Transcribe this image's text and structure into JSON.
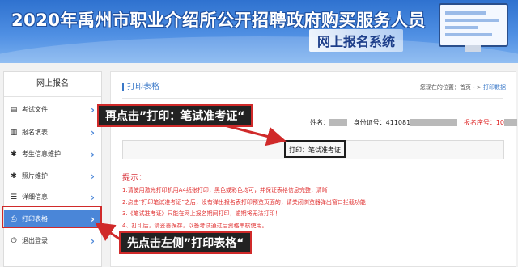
{
  "banner": {
    "title": "2020年禹州市职业介绍所公开招聘政府购买服务人员",
    "subtitle": "网上报名系统"
  },
  "sidebar": {
    "heading": "网上报名",
    "items": [
      {
        "label": "考试文件",
        "icon": "document-icon",
        "active": false
      },
      {
        "label": "报名填表",
        "icon": "form-icon",
        "active": false
      },
      {
        "label": "考生信息维护",
        "icon": "gear-icon",
        "active": false
      },
      {
        "label": "照片维护",
        "icon": "gear-icon",
        "active": false
      },
      {
        "label": "详细信息",
        "icon": "list-icon",
        "active": false
      },
      {
        "label": "打印表格",
        "icon": "printer-icon",
        "active": true
      },
      {
        "label": "退出登录",
        "icon": "power-icon",
        "active": false
      }
    ]
  },
  "main": {
    "title": "打印表格",
    "breadcrumb_prefix": "您现在的位置：首页",
    "breadcrumb_sep": " - > ",
    "breadcrumb_current": "打印数据",
    "name_label": "姓名：",
    "id_label": "身份证号：",
    "id_value": "411081",
    "reg_label": "报名序号：",
    "reg_value": "10",
    "print_button": "打印：笔试准考证",
    "tips_heading": "提示：",
    "tips": [
      "1.请使用激光打印机用A4纸张打印，黑色或彩色均可，并保证表格信息完整，清晰！",
      "2.点击“打印笔试准考证”之后，没有弹出报名表打印预览页面的，请关闭浏览器弹出窗口拦截功能！",
      "3.《笔试准考证》只能在网上报名期间打印，逾期将无法打印！",
      "4、打印后，请妥善保存，以备考试通过后资格审核使用。"
    ]
  },
  "annotations": {
    "callout_1": "再点击”打印：笔试准考证“",
    "callout_2": "先点击左侧”打印表格“"
  },
  "colors": {
    "accent": "#4a86d8",
    "annotation_red": "#d02a2a",
    "tip_red": "#e03030"
  }
}
